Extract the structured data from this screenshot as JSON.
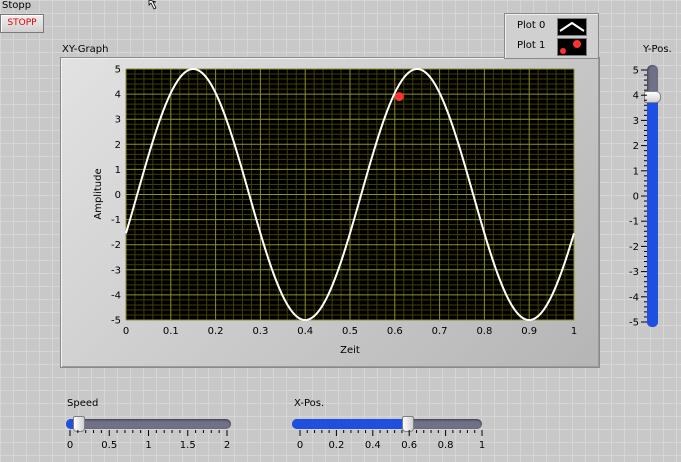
{
  "stop_control": {
    "label": "Stopp",
    "button_text": "STOPP"
  },
  "graph": {
    "title": "XY-Graph",
    "xlabel": "Zeit",
    "ylabel": "Amplitude",
    "x_ticks": [
      "0",
      "0.1",
      "0.2",
      "0.3",
      "0.4",
      "0.5",
      "0.6",
      "0.7",
      "0.8",
      "0.9",
      "1"
    ],
    "y_ticks": [
      "5",
      "4",
      "3",
      "2",
      "1",
      "0",
      "-1",
      "-2",
      "-3",
      "-4",
      "-5"
    ]
  },
  "legend": {
    "items": [
      {
        "label": "Plot 0"
      },
      {
        "label": "Plot 1"
      }
    ]
  },
  "speed_slider": {
    "label": "Speed",
    "ticks": [
      "0",
      "0.5",
      "1",
      "1.5",
      "2"
    ],
    "value": 0.1,
    "min": 0,
    "max": 2
  },
  "xpos_slider": {
    "label": "X-Pos.",
    "ticks": [
      "0",
      "0.2",
      "0.4",
      "0.6",
      "0.8",
      "1"
    ],
    "value": 0.61,
    "min": 0,
    "max": 1
  },
  "ypos_slider": {
    "label": "Y-Pos.",
    "ticks": [
      "5",
      "4",
      "3",
      "2",
      "1",
      "0",
      "-1",
      "-2",
      "-3",
      "-4",
      "-5"
    ],
    "value": 3.9,
    "min": -5,
    "max": 5
  },
  "colors": {
    "plot_bg": "#000000",
    "grid_major": "#8f8f2a",
    "grid_minor": "#404000",
    "sine": "#ffffff",
    "marker": "#ff3030",
    "slider_fill": "#1f4fe0",
    "stop_text": "#e00000"
  },
  "chart_data": {
    "type": "line",
    "xlim": [
      0,
      1
    ],
    "ylim": [
      -5,
      5
    ],
    "series": [
      {
        "function": "sine",
        "amplitude": 5,
        "period": 0.5,
        "phase_x_of_peak": 0.15,
        "x_range": [
          0,
          1
        ]
      },
      {
        "type": "scatter",
        "points": [
          {
            "x": 0.61,
            "y": 3.9
          }
        ]
      }
    ]
  }
}
